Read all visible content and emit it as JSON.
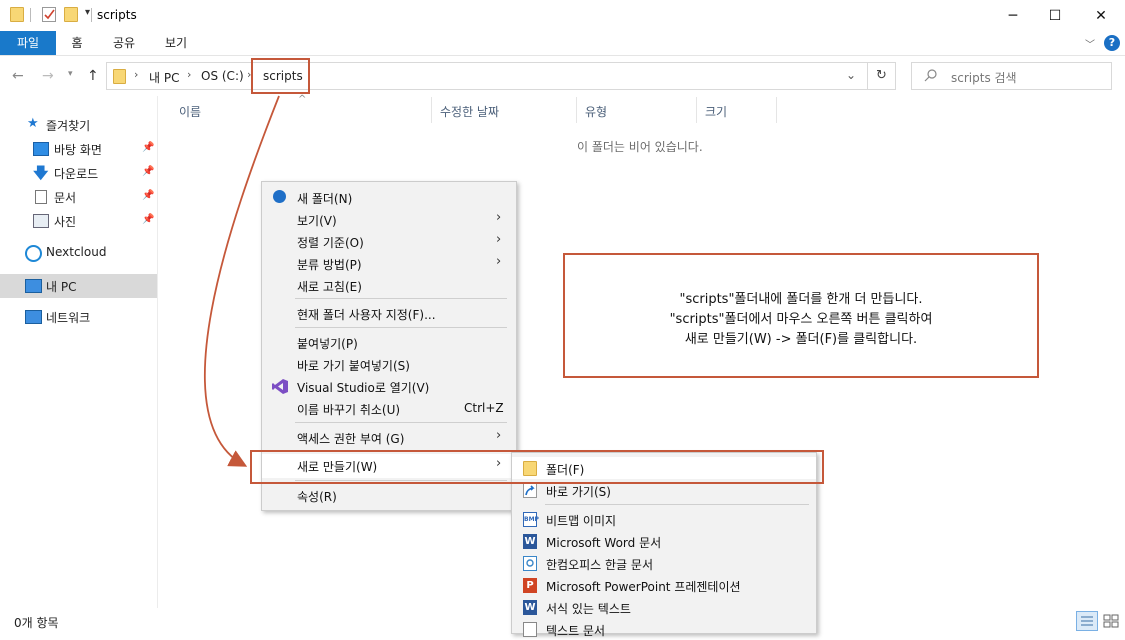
{
  "window": {
    "title": "scripts",
    "controls": {
      "minimize": "─",
      "maximize": "☐",
      "close": "✕"
    }
  },
  "ribbon": {
    "tabs": [
      "파일",
      "홈",
      "공유",
      "보기"
    ],
    "help_icon": "?"
  },
  "address": {
    "crumbs": [
      "내 PC",
      "OS (C:)",
      "scripts"
    ],
    "search_placeholder": "scripts 검색"
  },
  "nav": {
    "quick_access": "즐겨찾기",
    "pinned": [
      "바탕 화면",
      "다운로드",
      "문서",
      "사진"
    ],
    "nextcloud": "Nextcloud",
    "this_pc": "내 PC",
    "network": "네트워크"
  },
  "columns": [
    "이름",
    "수정한 날짜",
    "유형",
    "크기"
  ],
  "empty_message": "이 폴더는 비어 있습니다.",
  "context_menu": {
    "items": [
      {
        "label": "새 폴더(N)"
      },
      {
        "label": "보기(V)"
      },
      {
        "label": "정렬 기준(O)"
      },
      {
        "label": "분류 방법(P)"
      },
      {
        "label": "새로 고침(E)"
      },
      {
        "label": "현재 폴더 사용자 지정(F)..."
      },
      {
        "label": "붙여넣기(P)"
      },
      {
        "label": "바로 가기 붙여넣기(S)"
      },
      {
        "label": "Visual Studio로 열기(V)"
      },
      {
        "label": "이름 바꾸기 취소(U)",
        "shortcut": "Ctrl+Z"
      },
      {
        "label": "액세스 권한 부여 (G)"
      },
      {
        "label": "새로 만들기(W)"
      },
      {
        "label": "속성(R)"
      }
    ]
  },
  "submenu": {
    "items": [
      "폴더(F)",
      "바로 가기(S)",
      "비트맵 이미지",
      "Microsoft Word 문서",
      "한컴오피스 한글 문서",
      "Microsoft PowerPoint 프레젠테이션",
      "서식 있는 텍스트",
      "텍스트 문서"
    ]
  },
  "annotation": {
    "lines": [
      "\"scripts\"폴더내에 폴더를 한개 더 만듭니다.",
      "\"scripts\"폴더에서 마우스 오른쪽 버튼 클릭하여",
      "새로 만들기(W) -> 폴더(F)를 클릭합니다."
    ],
    "color": "#c5583a"
  },
  "status": {
    "item_count": "0개 항목"
  },
  "colors": {
    "accent": "#1979ca",
    "annotation": "#c5583a",
    "folder": "#f8d775"
  }
}
